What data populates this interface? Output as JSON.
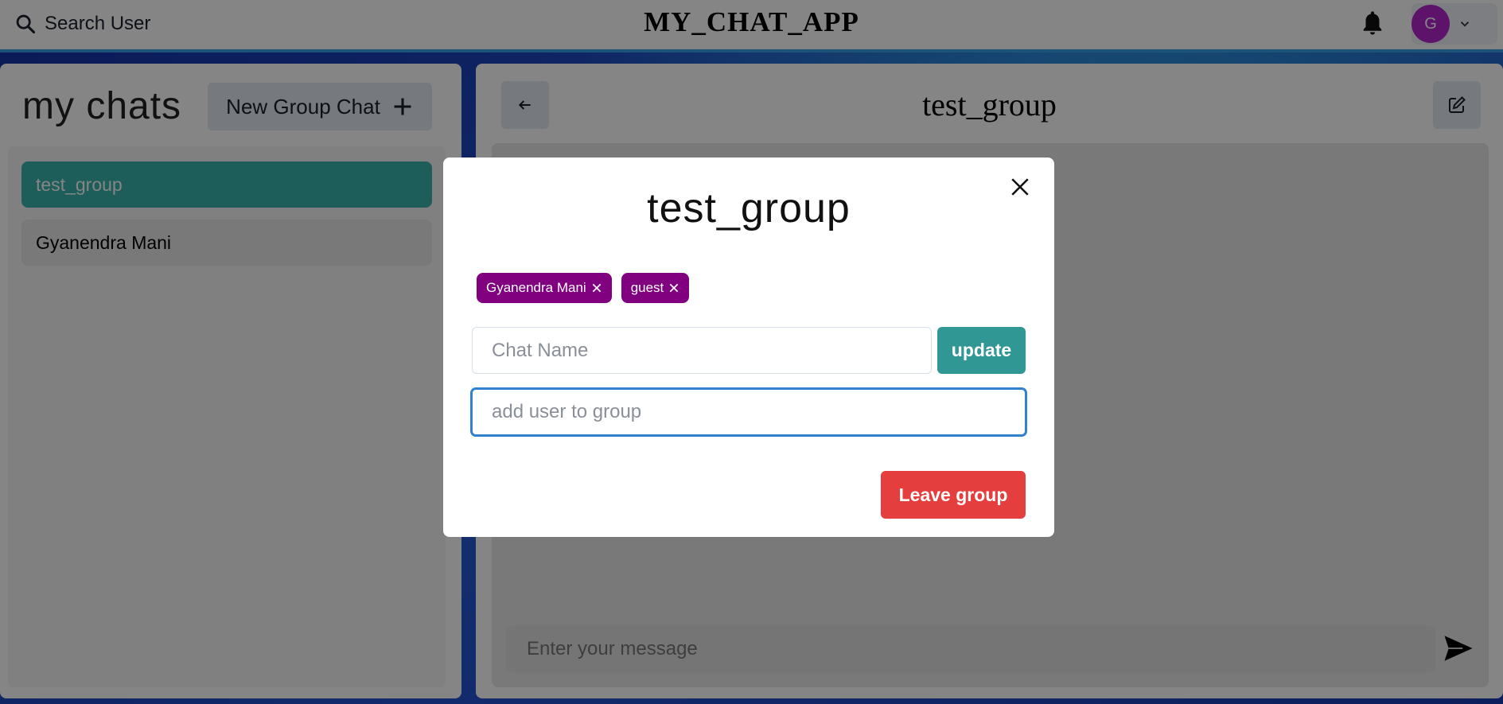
{
  "header": {
    "search_label": "Search User",
    "app_title": "MY_CHAT_APP",
    "avatar_initial": "G"
  },
  "sidebar": {
    "title": "my chats",
    "new_group_label": "New Group Chat",
    "chats": [
      {
        "name": "test_group",
        "active": true
      },
      {
        "name": "Gyanendra Mani",
        "active": false
      }
    ]
  },
  "chat": {
    "title": "test_group",
    "message_placeholder": "Enter your message"
  },
  "modal": {
    "title": "test_group",
    "members": [
      "Gyanendra Mani",
      "guest"
    ],
    "chat_name_placeholder": "Chat Name",
    "update_label": "update",
    "add_user_placeholder": "add user to group",
    "leave_label": "Leave group"
  },
  "colors": {
    "accent_teal": "#38b2ac",
    "member_badge": "#800080",
    "leave_red": "#e53e3e",
    "update_teal": "#319795",
    "avatar_bg": "#b026c9"
  },
  "icons": [
    "search-icon",
    "bell-icon",
    "chevron-down-icon",
    "plus-icon",
    "arrow-left-icon",
    "edit-icon",
    "send-icon",
    "close-icon"
  ]
}
